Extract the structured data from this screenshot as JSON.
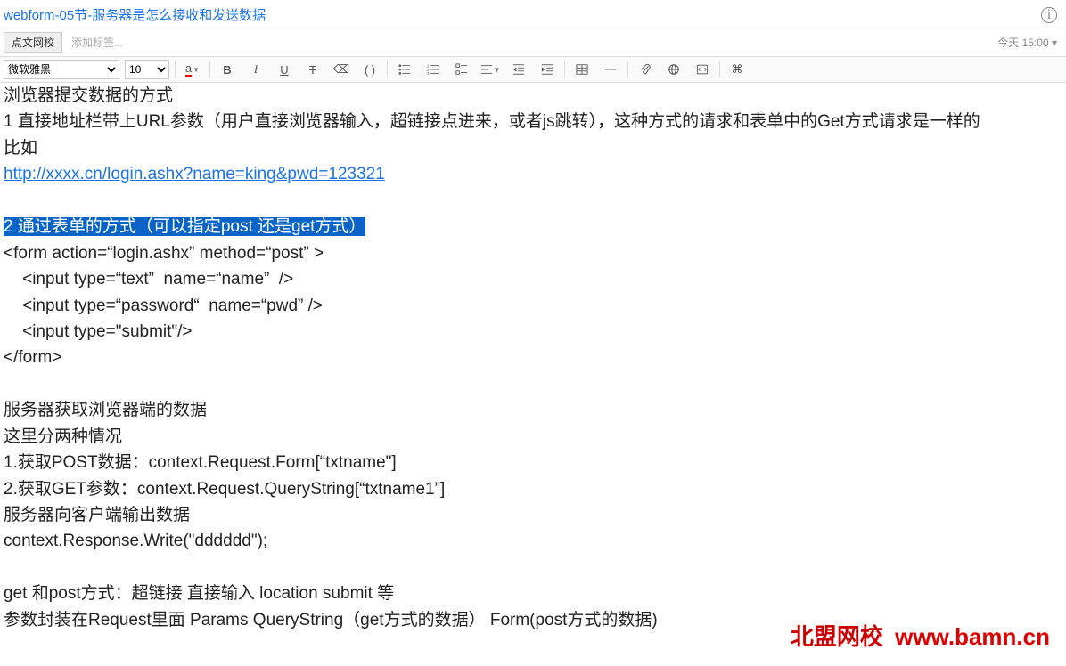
{
  "titleBar": {
    "title": "webform-05节-服务器是怎么接收和发送数据"
  },
  "tagRow": {
    "chip": "点文网校",
    "addTag": "添加标签...",
    "time": "今天 15:00 ▾"
  },
  "toolbar": {
    "font": "微软雅黑",
    "size": "10",
    "fontColorLetter": "a",
    "bold": "B",
    "italic": "I",
    "underline": "U",
    "strike": "T",
    "clear": "⌫",
    "brackets": "( )"
  },
  "content": {
    "l1": "浏览器提交数据的方式",
    "l2": "1 直接地址栏带上URL参数（用户直接浏览器输入，超链接点进来，或者js跳转），这种方式的请求和表单中的Get方式请求是一样的",
    "l3": "比如",
    "link1": "http://xxxx.cn/login.ashx?name=king&pwd=123321",
    "hl1": "2 通过表单的方式（可以指定post 还是get方式）",
    "code1": "<form action=“login.ashx”  method=“post” >",
    "code2": "    <input type=“text”  name=“name”  />",
    "code3": "    <input type=“password“  name=“pwd” />",
    "code4": "    <input type=\"submit\"/>",
    "code5": "</form>",
    "l4": "服务器获取浏览器端的数据",
    "l5": "这里分两种情况",
    "l6": "1.获取POST数据：context.Request.Form[“txtname\"]",
    "l7": "2.获取GET参数：context.Request.QueryString[“txtname1”]",
    "l8": "服务器向客户端输出数据",
    "l9": "context.Response.Write(\"dddddd\");",
    "l10": "get 和post方式：超链接 直接输入 location submit 等",
    "l11": "参数封装在Request里面 Params  QueryString（get方式的数据） Form(post方式的数据)"
  },
  "watermark": {
    "zh": "北盟网校",
    "url": "www.bamn.cn"
  }
}
